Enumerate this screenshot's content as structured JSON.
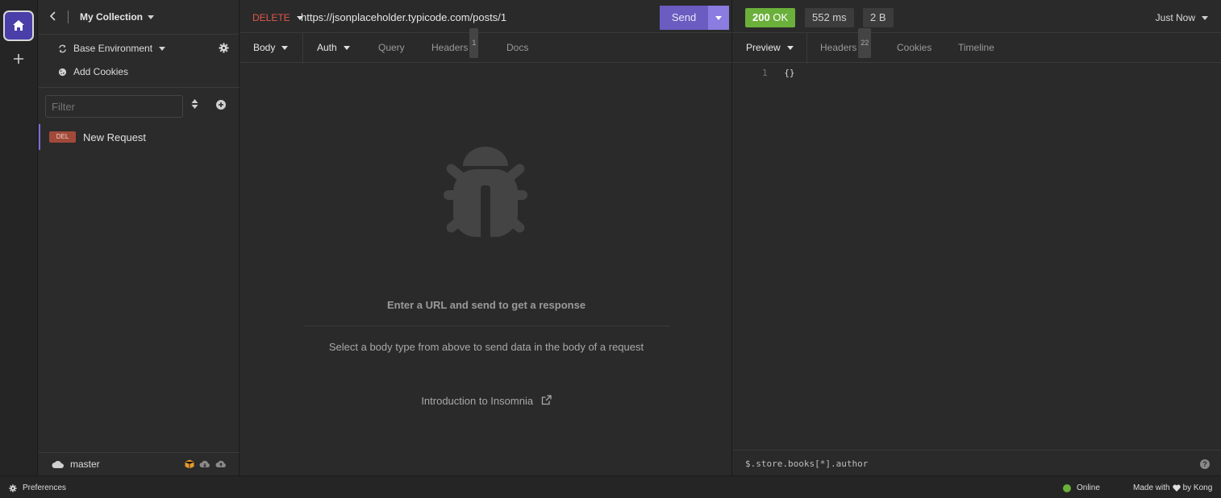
{
  "sidebar": {
    "collection_title": "My Collection",
    "environment_label": "Base Environment",
    "add_cookies_label": "Add Cookies",
    "filter_placeholder": "Filter",
    "requests": [
      {
        "method_badge": "DEL",
        "name": "New Request"
      }
    ],
    "branch": "master"
  },
  "request": {
    "method": "DELETE",
    "url": "https://jsonplaceholder.typicode.com/posts/1",
    "send_label": "Send",
    "tabs": {
      "body": "Body",
      "auth": "Auth",
      "query": "Query",
      "headers": "Headers",
      "headers_count": "1",
      "docs": "Docs"
    },
    "empty_title": "Enter a URL and send to get a response",
    "empty_subtitle": "Select a body type from above to send data in the body of a request",
    "intro_link": "Introduction to Insomnia"
  },
  "response": {
    "status_code": "200",
    "status_text": "OK",
    "time": "552 ms",
    "size": "2 B",
    "timestamp": "Just Now",
    "tabs": {
      "preview": "Preview",
      "headers": "Headers",
      "headers_count": "22",
      "cookies": "Cookies",
      "timeline": "Timeline"
    },
    "body_line_number": "1",
    "body_line": "{}",
    "filter_placeholder": "$.store.books[*].author",
    "help_glyph": "?"
  },
  "footer": {
    "preferences": "Preferences",
    "online": "Online",
    "made_with": "Made with",
    "by": "by Kong"
  },
  "colors": {
    "accent": "#6a5cc0",
    "method_delete": "#e2574c",
    "status_ok": "#6ab03a",
    "background": "#2a2a2a"
  }
}
